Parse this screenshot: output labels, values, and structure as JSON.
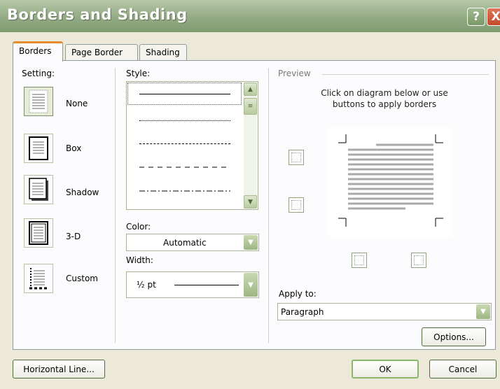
{
  "window": {
    "title": "Borders and Shading",
    "help_glyph": "?",
    "close_glyph": "X"
  },
  "tabs": [
    {
      "label": "Borders"
    },
    {
      "label": "Page Border"
    },
    {
      "label": "Shading"
    }
  ],
  "setting": {
    "heading": "Setting:",
    "items": [
      {
        "label": "None"
      },
      {
        "label": "Box"
      },
      {
        "label": "Shadow"
      },
      {
        "label": "3-D"
      },
      {
        "label": "Custom"
      }
    ]
  },
  "style": {
    "heading": "Style:",
    "lines": [
      "solid",
      "dotted",
      "dashed-fine",
      "dashed",
      "dash-dot"
    ]
  },
  "color": {
    "heading": "Color:",
    "value": "Automatic"
  },
  "width": {
    "heading": "Width:",
    "value": "½ pt"
  },
  "preview": {
    "heading": "Preview",
    "instruction": "Click on diagram below or use buttons to apply borders"
  },
  "apply_to": {
    "heading": "Apply to:",
    "value": "Paragraph"
  },
  "buttons": {
    "options": "Options...",
    "horizontal_line": "Horizontal Line...",
    "ok": "OK",
    "cancel": "Cancel"
  },
  "colors": {
    "titlebar": "#93ab84",
    "accent_tab": "#e68b2c",
    "control_border": "#a6b394"
  }
}
